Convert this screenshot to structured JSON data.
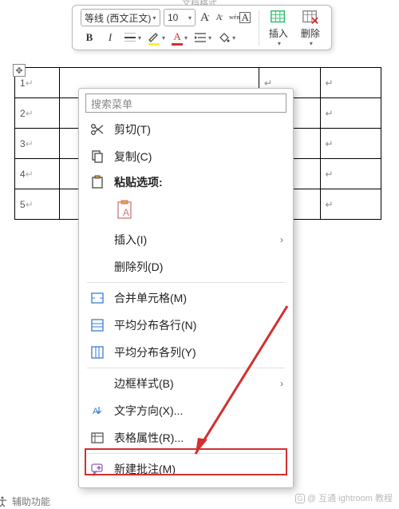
{
  "ribbon_hint": "文档格式",
  "ribbon": {
    "font_name": "等线 (西文正文)",
    "font_size": "10",
    "insert_label": "插入",
    "delete_label": "删除"
  },
  "table": {
    "rows": [
      "1",
      "2",
      "3",
      "4",
      "5"
    ]
  },
  "context_menu": {
    "search_placeholder": "搜索菜单",
    "items": {
      "cut": "剪切(T)",
      "copy": "复制(C)",
      "paste_options": "粘贴选项:",
      "insert": "插入(I)",
      "delete_col": "删除列(D)",
      "merge_cells": "合并单元格(M)",
      "dist_rows": "平均分布各行(N)",
      "dist_cols": "平均分布各列(Y)",
      "border_style": "边框样式(B)",
      "text_direction": "文字方向(X)...",
      "table_properties": "表格属性(R)...",
      "new_comment": "新建批注(M)"
    }
  },
  "footer": "辅助功能",
  "watermark": "@ 互通 ightroom 教程"
}
